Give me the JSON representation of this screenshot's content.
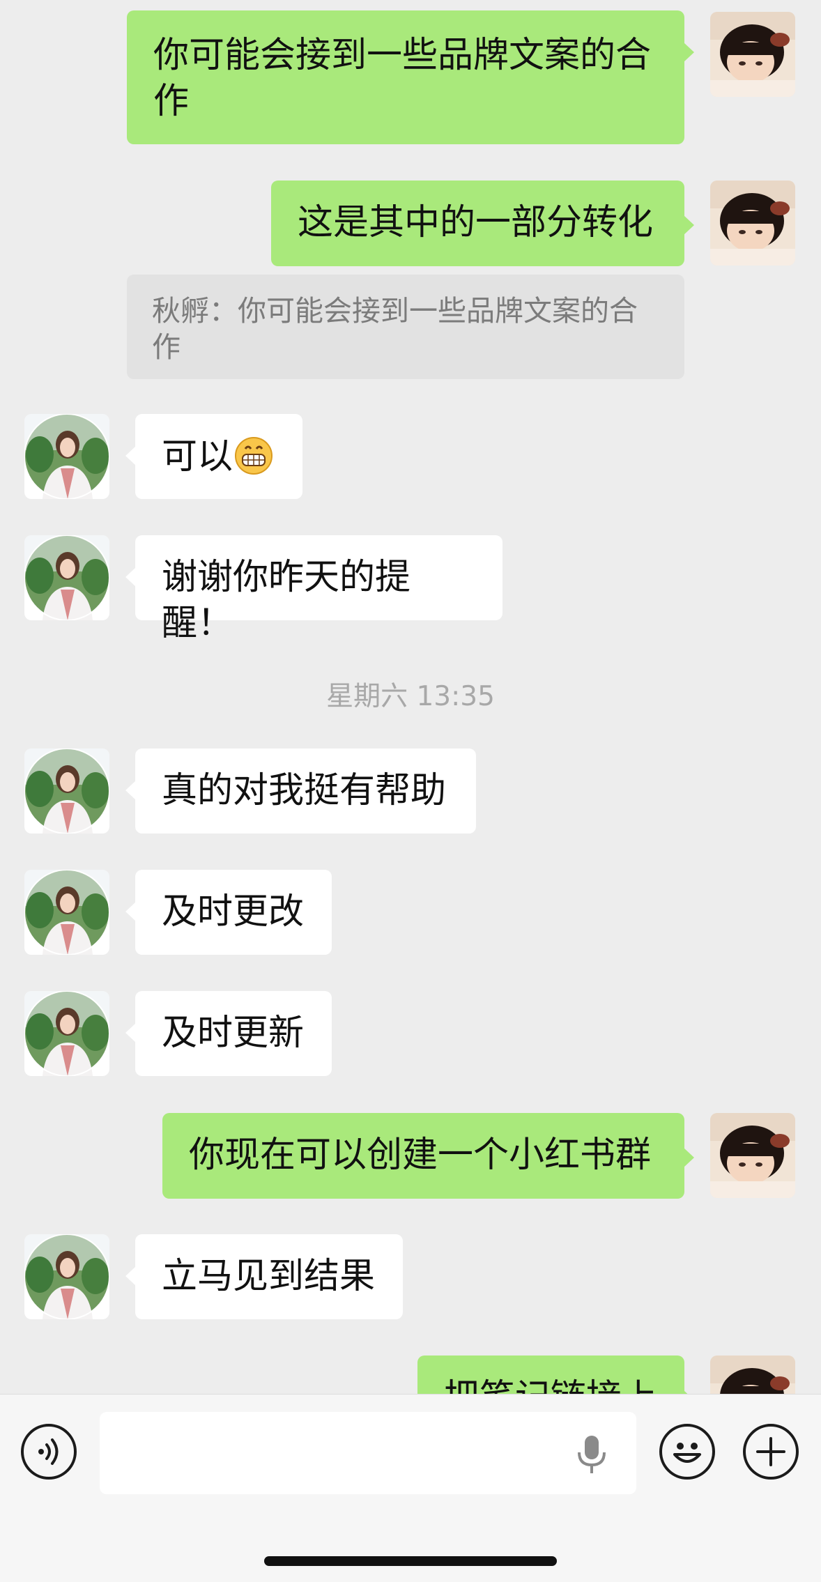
{
  "messages": [
    {
      "side": "self",
      "text": "你可能会接到一些品牌文案的合作"
    },
    {
      "side": "self",
      "text": "这是其中的一部分转化"
    },
    {
      "type": "quote",
      "text": "秋孵：你可能会接到一些品牌文案的合作"
    },
    {
      "side": "other",
      "text": "可以",
      "emoji": "grinning-emoji"
    },
    {
      "side": "other",
      "text": "谢谢你昨天的提醒！"
    },
    {
      "type": "time",
      "text": "星期六 13:35"
    },
    {
      "side": "other",
      "text": "真的对我挺有帮助"
    },
    {
      "side": "other",
      "text": "及时更改"
    },
    {
      "side": "other",
      "text": "及时更新"
    },
    {
      "side": "self",
      "text": "你现在可以创建一个小红书群"
    },
    {
      "side": "other",
      "text": "立马见到结果"
    },
    {
      "side": "self",
      "text": "把笔记链接上"
    }
  ],
  "input_bar": {
    "icons": [
      "voice-icon",
      "microphone-icon",
      "emoji-icon",
      "plus-icon"
    ],
    "text_value": ""
  },
  "colors": {
    "background": "#ededed",
    "self_bubble": "#a9e97b",
    "other_bubble": "#ffffff",
    "quote_bubble": "#e2e2e2",
    "timestamp": "#a8a8a8"
  }
}
